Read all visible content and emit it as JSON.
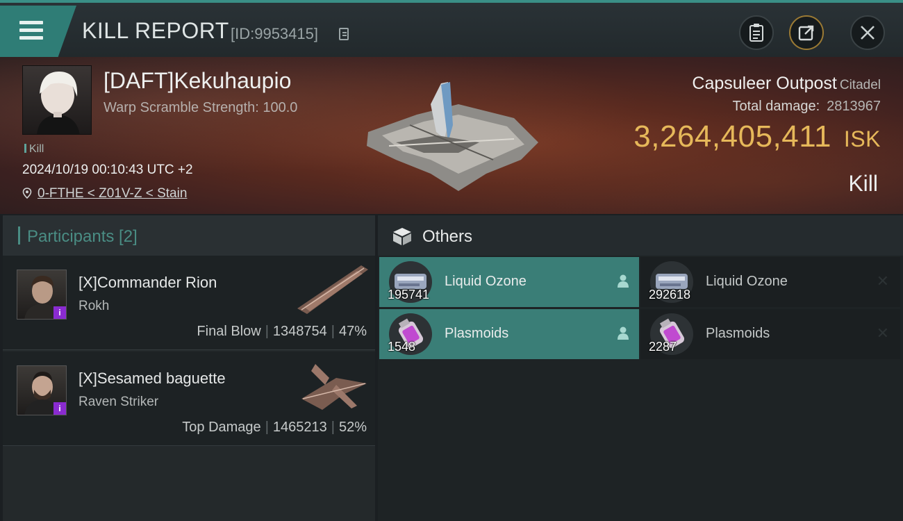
{
  "header": {
    "title": "KILL REPORT",
    "report_id": "[ID:9953415]",
    "icons": [
      "menu-icon",
      "copy-icon",
      "clipboard-icon",
      "share-icon",
      "close-icon"
    ]
  },
  "victim": {
    "name": "[DAFT]Kekuhaupio",
    "warp_scramble": "Warp Scramble Strength: 100.0",
    "tag": "Kill",
    "datetime": "2024/10/19 00:10:43 UTC +2",
    "location": "0-FTHE < Z01V-Z < Stain",
    "target_name": "Capsuleer Outpost",
    "target_class": "Citadel",
    "total_damage_label": "Total damage:",
    "total_damage_value": "2813967",
    "isk_value": "3,264,405,411",
    "isk_unit": "ISK",
    "kind": "Kill"
  },
  "participants": {
    "title": "Participants [2]",
    "items": [
      {
        "name": "[X]Commander Rion",
        "ship": "Rokh",
        "role": "Final Blow",
        "damage": "1348754",
        "percent": "47%"
      },
      {
        "name": "[X]Sesamed baguette",
        "ship": "Raven Striker",
        "role": "Top Damage",
        "damage": "1465213",
        "percent": "52%"
      }
    ]
  },
  "others": {
    "title": "Others",
    "items": [
      {
        "name": "Liquid Ozone",
        "qty": "195741",
        "state": "selected"
      },
      {
        "name": "Liquid Ozone",
        "qty": "292618",
        "state": "dimmed"
      },
      {
        "name": "Plasmoids",
        "qty": "1548",
        "state": "selected"
      },
      {
        "name": "Plasmoids",
        "qty": "2287",
        "state": "dimmed"
      }
    ]
  },
  "colors": {
    "accent": "#3a7e77",
    "isk_gold": "#e6b85a",
    "banner_red": "#5a2a1f"
  }
}
